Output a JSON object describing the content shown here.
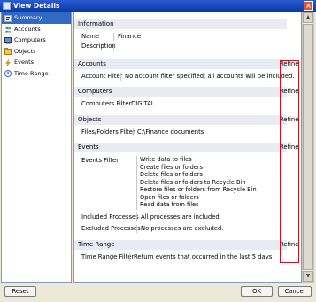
{
  "window": {
    "title": "View Details"
  },
  "sidebar": {
    "items": [
      {
        "label": "Summary",
        "icon": "summary-icon",
        "active": true
      },
      {
        "label": "Accounts",
        "icon": "accounts-icon"
      },
      {
        "label": "Computers",
        "icon": "computers-icon"
      },
      {
        "label": "Objects",
        "icon": "objects-icon"
      },
      {
        "label": "Events",
        "icon": "events-icon"
      },
      {
        "label": "Time Range",
        "icon": "time-range-icon"
      }
    ]
  },
  "main": {
    "information": {
      "header": "Information",
      "name_label": "Name",
      "name_value": "Finance",
      "description_label": "Description",
      "description_value": ""
    },
    "accounts": {
      "header": "Accounts",
      "filter_label": "Account Filter",
      "filter_value": "No account filter specified; all accounts will be included.",
      "refine": "Refine"
    },
    "computers": {
      "header": "Computers",
      "filter_label": "Computers Filter",
      "filter_value": "DIGITAL",
      "refine": "Refine"
    },
    "objects": {
      "header": "Objects",
      "filter_label": "Files/Folders Filter",
      "filter_value": "C:\\Finance documents",
      "refine": "Refine"
    },
    "events": {
      "header": "Events",
      "filter_label": "Events Filter",
      "filter_values": [
        "Write data to files",
        "Create files or folders",
        "Delete files or folders",
        "Delete files or folders to Recycle Bin",
        "Restore files or folders from Recycle Bin",
        "Open files or folders",
        "Read data from files"
      ],
      "included_label": "Included Processes",
      "included_value": "All processes are included.",
      "excluded_label": "Excluded Processes",
      "excluded_value": "No processes are excluded.",
      "refine": "Refine"
    },
    "time_range": {
      "header": "Time Range",
      "filter_label": "Time Range Filter",
      "filter_value": "Return events that occurred in the last 5 days",
      "refine": "Refine"
    }
  },
  "footer": {
    "reset": "Reset",
    "ok": "OK",
    "cancel": "Cancel"
  },
  "colors": {
    "title_bar": "#0b3aa6",
    "selection": "#316ac5",
    "highlight_box": "#d0101a"
  }
}
